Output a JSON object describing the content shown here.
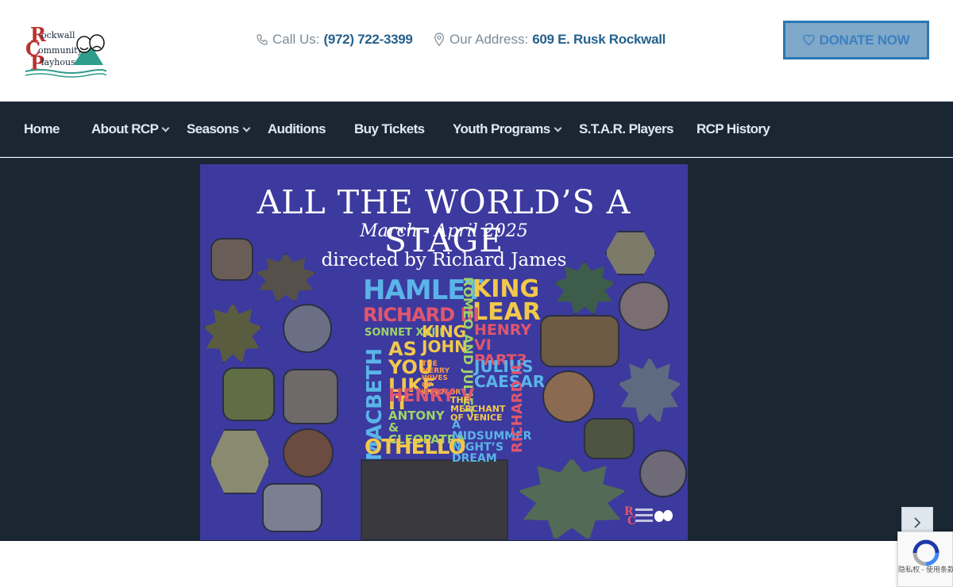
{
  "site": {
    "logo_text": "Rockwall Community Playhouse",
    "accent_color": "#25618d",
    "nav_bg_color": "#1b2633"
  },
  "header": {
    "call_label": "Call Us:",
    "phone": "(972) 722-3399",
    "address_label": "Our Address:",
    "address": "609 E. Rusk Rockwall",
    "donate_label": "DONATE NOW",
    "donate_icon": "heart-icon"
  },
  "nav": {
    "items": [
      {
        "label": "Home",
        "has_submenu": false
      },
      {
        "label": "About RCP",
        "has_submenu": true
      },
      {
        "label": "Seasons",
        "has_submenu": true
      },
      {
        "label": "Auditions",
        "has_submenu": false
      },
      {
        "label": "Buy Tickets",
        "has_submenu": false
      },
      {
        "label": "Youth Programs",
        "has_submenu": true
      },
      {
        "label": "S.T.A.R. Players",
        "has_submenu": false
      },
      {
        "label": "RCP History",
        "has_submenu": false
      }
    ]
  },
  "slider": {
    "poster": {
      "title": "ALL THE WORLD’S A STAGE",
      "dates": "March - April 2025",
      "director": "directed by Richard James",
      "plays": [
        "HAMLET",
        "KING LEAR",
        "RICHARD III",
        "SONNET XVIII",
        "KING JOHN",
        "ROMEO AND JULIET",
        "HENRY VI PART3",
        "AS YOU LIKE IT",
        "THE MERRY WIVES OF WINDSOR",
        "JULIUS CAESAR",
        "MACBETH",
        "HENRY V",
        "THE MERCHANT OF VENICE",
        "ANTONY & CLEOPATRA",
        "A MIDSUMMER NIGHT’S DREAM",
        "RICHARD II",
        "OTHELLO"
      ]
    },
    "next_icon": "chevron-right-icon"
  },
  "recaptcha": {
    "text": "隐私权 - 使用条款"
  }
}
